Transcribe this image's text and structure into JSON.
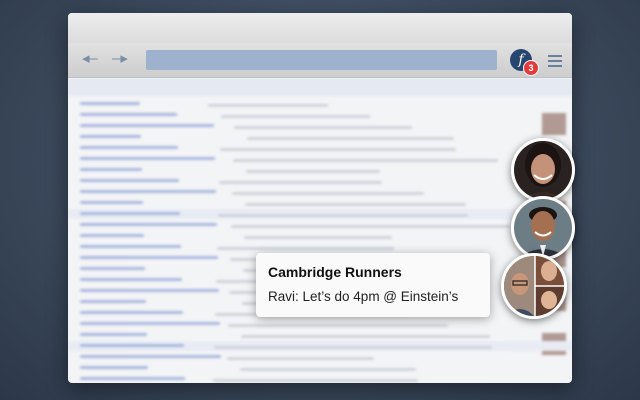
{
  "toolbar": {
    "back_icon": "back-arrow-icon",
    "forward_icon": "forward-arrow-icon",
    "back_glyph": "◂–",
    "forward_glyph": "–▸",
    "fb_glyph": "f",
    "notification_count": "3",
    "menu_icon": "hamburger-menu-icon"
  },
  "chat_heads": [
    {
      "name": "chat-head-woman",
      "icon": "avatar-photo"
    },
    {
      "name": "chat-head-man",
      "icon": "avatar-photo"
    },
    {
      "name": "chat-head-group",
      "icon": "group-avatar-photo"
    }
  ],
  "notification": {
    "title": "Cambridge Runners",
    "message": "Ravi: Let’s do 4pm @ Einstein’s"
  },
  "colors": {
    "desktop": "#3c4a5d",
    "facebook_blue": "#27466f",
    "badge_red": "#e23b3b",
    "url_bar": "#9fb2cd"
  }
}
